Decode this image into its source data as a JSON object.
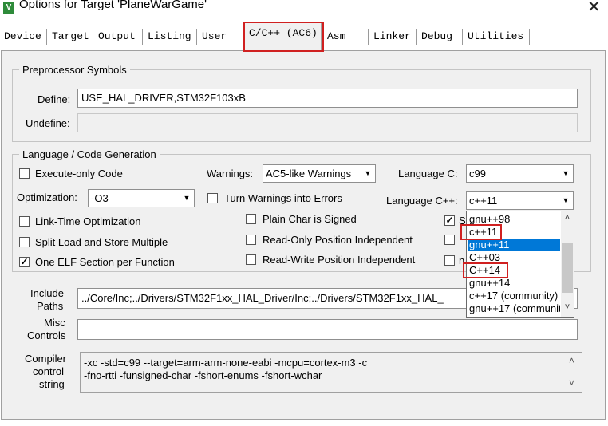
{
  "window": {
    "title": "Options for Target 'PlaneWarGame'",
    "app_icon_letter": "V",
    "close_glyph": "✕"
  },
  "tabs": [
    {
      "label": "Device"
    },
    {
      "label": "Target"
    },
    {
      "label": "Output"
    },
    {
      "label": "Listing"
    },
    {
      "label": "User"
    },
    {
      "label": "C/C++ (AC6)",
      "active": true
    },
    {
      "label": "Asm"
    },
    {
      "label": "Linker"
    },
    {
      "label": "Debug"
    },
    {
      "label": "Utilities"
    }
  ],
  "preprocessor": {
    "legend": "Preprocessor Symbols",
    "define_label": "Define:",
    "define_value": "USE_HAL_DRIVER,STM32F103xB",
    "undefine_label": "Undefine:",
    "undefine_value": ""
  },
  "language": {
    "legend": "Language / Code Generation",
    "execute_only": {
      "label": "Execute-only Code",
      "checked": false
    },
    "warnings_label": "Warnings:",
    "warnings_value": "AC5-like Warnings",
    "language_c_label": "Language C:",
    "language_c_value": "c99",
    "optimization_label": "Optimization:",
    "optimization_value": "-O3",
    "turn_warnings": {
      "label": "Turn Warnings into Errors",
      "checked": false
    },
    "language_cpp_label": "Language C++:",
    "language_cpp_value": "c++11",
    "lto": {
      "label": "Link-Time Optimization",
      "checked": false
    },
    "plain_char": {
      "label": "Plain Char is Signed",
      "checked": false
    },
    "split_load": {
      "label": "Split Load and Store Multiple",
      "checked": false
    },
    "ropi": {
      "label": "Read-Only Position Independent",
      "checked": false
    },
    "one_elf": {
      "label": "One ELF Section per Function",
      "checked": true
    },
    "rwpi": {
      "label": "Read-Write Position Independent",
      "checked": false
    },
    "hidden_checks": {
      "c1": "S",
      "c3": "n",
      "check_glyph": "✓"
    }
  },
  "dropdown": {
    "options": [
      "gnu++98",
      "c++11",
      "gnu++11",
      "C++03",
      "C++14",
      "gnu++14",
      "c++17 (community)",
      "gnu++17 (community)"
    ],
    "selected_index": 2,
    "scroll_up": "˄",
    "scroll_down": "˅"
  },
  "include": {
    "label_line1": "Include",
    "label_line2": "Paths",
    "value": "../Core/Inc;../Drivers/STM32F1xx_HAL_Driver/Inc;../Drivers/STM32F1xx_HAL_"
  },
  "misc": {
    "label_line1": "Misc",
    "label_line2": "Controls",
    "value": ""
  },
  "compiler": {
    "label_line1": "Compiler",
    "label_line2": "control",
    "label_line3": "string",
    "line1": "-xc -std=c99 --target=arm-arm-none-eabi -mcpu=cortex-m3 -c",
    "line2": "-fno-rtti -funsigned-char -fshort-enums -fshort-wchar"
  },
  "colors": {
    "selection": "#0078d7",
    "highlight_box": "#d02020",
    "panel": "#f0f0f0"
  }
}
